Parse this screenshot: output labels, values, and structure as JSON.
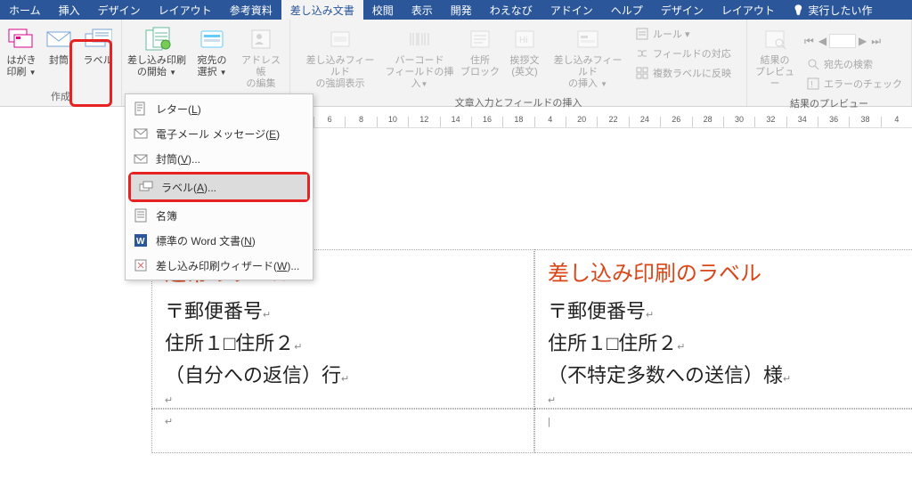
{
  "tabs": {
    "home": "ホーム",
    "insert": "挿入",
    "design": "デザイン",
    "layout": "レイアウト",
    "references": "参考資料",
    "mailings": "差し込み文書",
    "review": "校閲",
    "view": "表示",
    "developer": "開発",
    "waenabi": "わえなび",
    "addin": "アドイン",
    "help": "ヘルプ",
    "design2": "デザイン",
    "layout2": "レイアウト",
    "tellme": "実行したい作"
  },
  "ribbon": {
    "create": {
      "hagaki": "はがき\n印刷 ▾",
      "envelope": "封筒",
      "label": "ラベル",
      "group": "作成"
    },
    "start": {
      "start": "差し込み印刷\nの開始 ▾",
      "recipients": "宛先の\n選択 ▾",
      "editlist": "アドレス帳\nの編集"
    },
    "write": {
      "highlight": "差し込みフィールド\nの強調表示",
      "barcode": "バーコード\nフィールドの挿入▾",
      "address": "住所\nブロック",
      "greeting": "挨拶文\n(英文)",
      "insertfield": "差し込みフィールド\nの挿入 ▾",
      "rules": "ルール ▾",
      "match": "フィールドの対応",
      "update": "複数ラベルに反映",
      "group": "文章入力とフィールドの挿入"
    },
    "preview": {
      "preview": "結果の\nプレビュー",
      "find": "宛先の検索",
      "errors": "エラーのチェック",
      "group": "結果のプレビュー"
    }
  },
  "dropdown": {
    "letter": "レター(L)",
    "email": "電子メール メッセージ(E)",
    "envelope": "封筒(V)...",
    "label": "ラベル(A)...",
    "directory": "名簿",
    "normal": "標準の Word 文書(N)",
    "wizard": "差し込み印刷ウィザード(W)..."
  },
  "ruler": [
    "6",
    "8",
    "10",
    "12",
    "14",
    "16",
    "18",
    "4",
    "20",
    "22",
    "24",
    "26",
    "28",
    "30",
    "32",
    "34",
    "36",
    "38",
    "4"
  ],
  "doc": {
    "left": {
      "title": "通常のラベル",
      "line1": "〒郵便番号",
      "line2": "住所１□住所２",
      "line3": "（自分への返信）行"
    },
    "right": {
      "title": "差し込み印刷のラベル",
      "line1": "〒郵便番号",
      "line2": "住所１□住所２",
      "line3": "（不特定多数への送信）様"
    }
  }
}
